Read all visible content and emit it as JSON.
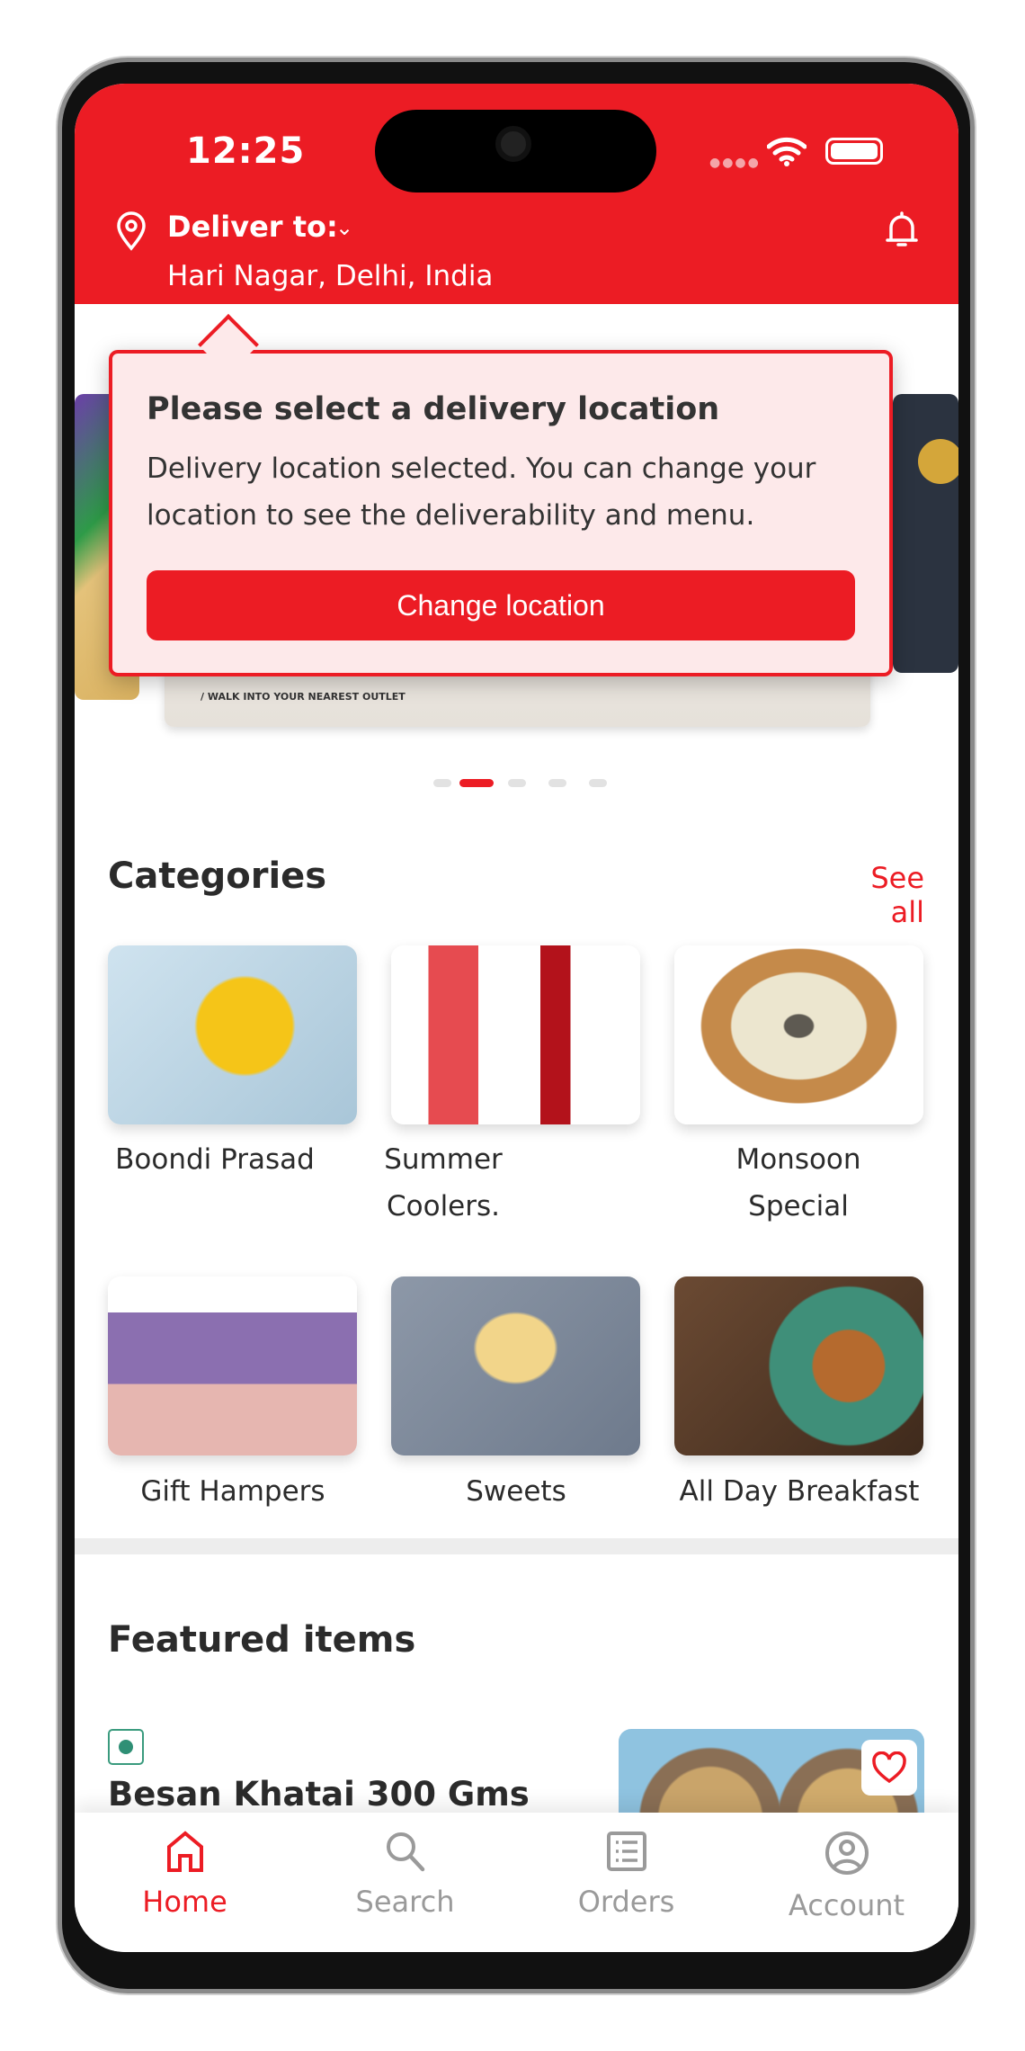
{
  "status_bar": {
    "time": "12:25"
  },
  "header": {
    "deliver_label": "Deliver to:",
    "address": "Hari Nagar, Delhi, India"
  },
  "banner": {
    "caption": "/ WALK INTO YOUR NEAREST OUTLET",
    "active_slide": 2,
    "slide_count": 5
  },
  "popover": {
    "title": "Please select a delivery location",
    "body": "Delivery location selected. You can change your location to see the deliverability and menu.",
    "button": "Change location"
  },
  "categories": {
    "title": "Categories",
    "see_all": "See all",
    "items": [
      {
        "label": "Boondi Prasad"
      },
      {
        "label": "Summer Coolers."
      },
      {
        "label": "Monsoon Special"
      },
      {
        "label": "Gift Hampers"
      },
      {
        "label": "Sweets"
      },
      {
        "label": "All Day Breakfast"
      }
    ]
  },
  "featured": {
    "title": "Featured items",
    "items": [
      {
        "name": "Besan Khatai 300 Gms",
        "veg": true
      }
    ]
  },
  "nav": {
    "items": [
      {
        "label": "Home",
        "active": true
      },
      {
        "label": "Search"
      },
      {
        "label": "Orders"
      },
      {
        "label": "Account"
      }
    ]
  },
  "colors": {
    "brand": "#ec1c24",
    "popover_bg": "#fde9ea",
    "veg": "#2f8f75",
    "inactive": "#9a9a9a"
  }
}
